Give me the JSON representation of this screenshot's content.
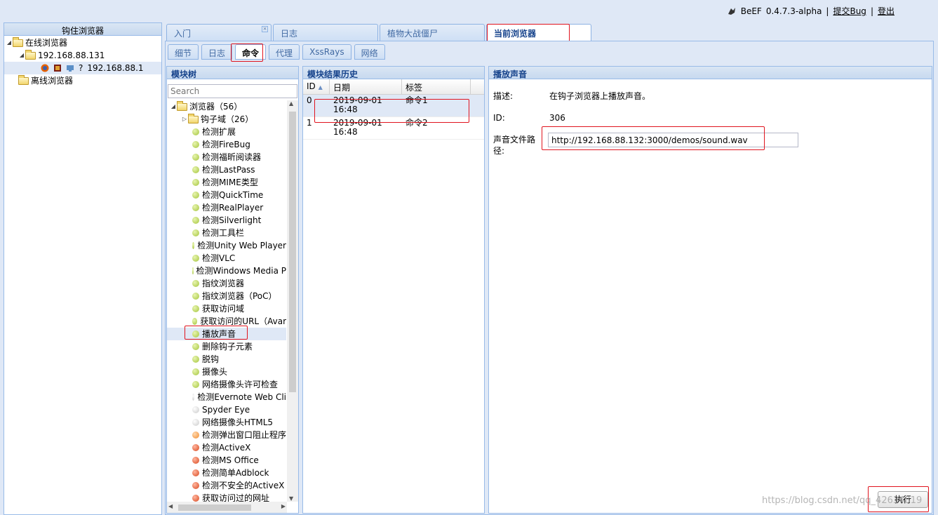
{
  "header": {
    "app_name": "BeEF",
    "version": "0.4.7.3-alpha",
    "sep": "|",
    "submit_bug": "提交Bug",
    "logout": "登出"
  },
  "left_panel": {
    "title": "钩住浏览器",
    "online": "在线浏览器",
    "host": "192.168.88.131",
    "question_mark": "?",
    "browser_ip": "192.168.88.1",
    "offline": "离线浏览器"
  },
  "tabs": [
    {
      "label": "入门",
      "close": "×"
    },
    {
      "label": "日志"
    },
    {
      "label": "植物大战僵尸"
    },
    {
      "label": "当前浏览器"
    }
  ],
  "subtabs": [
    "细节",
    "日志",
    "命令",
    "代理",
    "XssRays",
    "网络"
  ],
  "module_tree": {
    "title": "模块树",
    "search_placeholder": "Search",
    "root": "浏览器（56）",
    "hooked_domain": "钩子域（26）",
    "items": [
      {
        "label": "检测扩展",
        "status": "green"
      },
      {
        "label": "检测FireBug",
        "status": "green"
      },
      {
        "label": "检测福昕阅读器",
        "status": "green"
      },
      {
        "label": "检测LastPass",
        "status": "green"
      },
      {
        "label": "检测MIME类型",
        "status": "green"
      },
      {
        "label": "检测QuickTime",
        "status": "green"
      },
      {
        "label": "检测RealPlayer",
        "status": "green"
      },
      {
        "label": "检测Silverlight",
        "status": "green"
      },
      {
        "label": "检测工具栏",
        "status": "green"
      },
      {
        "label": "检测Unity Web Player",
        "status": "green"
      },
      {
        "label": "检测VLC",
        "status": "green"
      },
      {
        "label": "检测Windows Media P",
        "status": "green"
      },
      {
        "label": "指纹浏览器",
        "status": "green"
      },
      {
        "label": "指纹浏览器（PoC）",
        "status": "green"
      },
      {
        "label": "获取访问域",
        "status": "green"
      },
      {
        "label": "获取访问的URL（Avar",
        "status": "green"
      },
      {
        "label": "播放声音",
        "status": "green"
      },
      {
        "label": "删除钩子元素",
        "status": "green"
      },
      {
        "label": "脱钩",
        "status": "green"
      },
      {
        "label": "摄像头",
        "status": "green"
      },
      {
        "label": "网络摄像头许可检查",
        "status": "green"
      },
      {
        "label": "检测Evernote Web Cli",
        "status": "grey"
      },
      {
        "label": "Spyder Eye",
        "status": "grey"
      },
      {
        "label": "网络摄像头HTML5",
        "status": "grey"
      },
      {
        "label": "检测弹出窗口阻止程序",
        "status": "orange"
      },
      {
        "label": "检测ActiveX",
        "status": "red"
      },
      {
        "label": "检测MS Office",
        "status": "red"
      },
      {
        "label": "检测简单Adblock",
        "status": "red"
      },
      {
        "label": "检测不安全的ActiveX",
        "status": "red"
      },
      {
        "label": "获取访问过的网址",
        "status": "red"
      }
    ]
  },
  "history": {
    "title": "模块结果历史",
    "columns": [
      "ID",
      "日期",
      "标签"
    ],
    "sort_glyph": "▲",
    "rows": [
      {
        "id": "0",
        "date": "2019-09-01",
        "time": "16:48",
        "label": "命令1"
      },
      {
        "id": "1",
        "date": "2019-09-01",
        "time": "16:48",
        "label": "命令2"
      }
    ]
  },
  "detail": {
    "title": "播放声音",
    "desc_label": "描述:",
    "desc_value": "在钩子浏览器上播放声音。",
    "id_label": "ID:",
    "id_value": "306",
    "path_label": "声音文件路径:",
    "path_value": "http://192.168.88.132:3000/demos/sound.wav",
    "execute_button": "执行"
  },
  "watermark": "https://blog.csdn.net/qq_42634819",
  "colors": {
    "highlight": "#e0141e",
    "header_bg": "#c7d9ef",
    "selection": "#dfe8f6"
  }
}
